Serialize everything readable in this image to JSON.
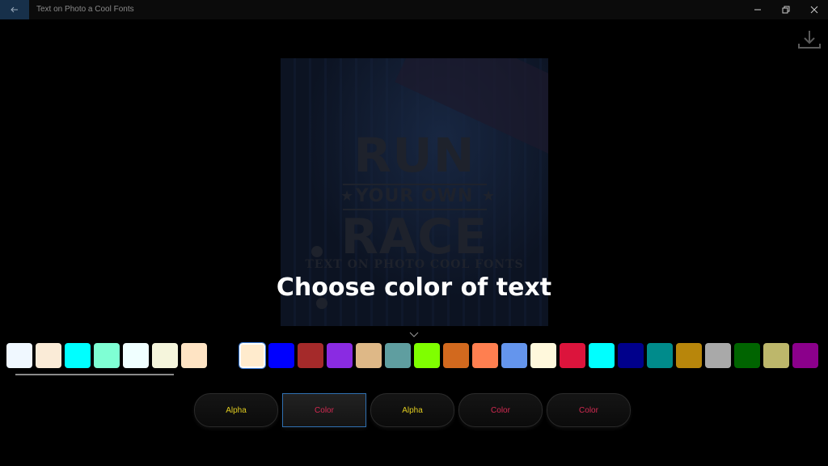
{
  "window": {
    "title": "Text on Photo a Cool Fonts"
  },
  "canvas": {
    "overlay_text": "Choose color of text",
    "ghost": {
      "line1": "RUN",
      "line2": "YOUR OWN",
      "line3": "RACE",
      "line4": "TEXT ON PHOTO COOL FONTS"
    }
  },
  "palette_left": {
    "colors": [
      "#f0f8ff",
      "#faebd7",
      "#00ffff",
      "#7fffd4",
      "#f0ffff",
      "#f5f5dc",
      "#ffe4c4"
    ]
  },
  "palette_right": {
    "selected_index": 0,
    "colors": [
      "#ffebcd",
      "#0000ff",
      "#a52a2a",
      "#8a2be2",
      "#deb887",
      "#5f9ea0",
      "#7fff00",
      "#d2691e",
      "#ff7f50",
      "#6495ed",
      "#fff8dc",
      "#dc143c",
      "#00ffff",
      "#00008b",
      "#008b8b",
      "#b8860b",
      "#a9a9a9",
      "#006400",
      "#bdb76b",
      "#8b008b"
    ]
  },
  "options": [
    {
      "label": "Alpha",
      "kind": "alpha",
      "active": false
    },
    {
      "label": "Color",
      "kind": "color",
      "active": true
    },
    {
      "label": "Alpha",
      "kind": "alpha",
      "active": false
    },
    {
      "label": "Color",
      "kind": "color",
      "active": false
    },
    {
      "label": "Color",
      "kind": "color",
      "active": false
    }
  ],
  "icons": {
    "back": "arrow-left-icon",
    "download": "download-icon",
    "expand": "chevron-down-icon"
  }
}
